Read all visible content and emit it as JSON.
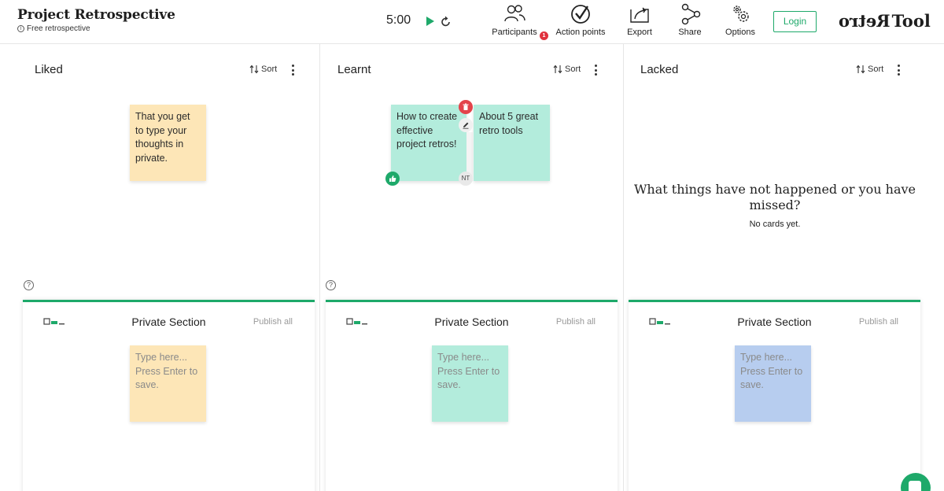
{
  "header": {
    "title": "Project Retrospective",
    "subtitle": "Free retrospective",
    "timer": "5:00",
    "tools": [
      {
        "label": "Participants",
        "icon": "participants-icon",
        "badge": "1"
      },
      {
        "label": "Action points",
        "icon": "action-points-icon"
      },
      {
        "label": "Export",
        "icon": "export-icon"
      },
      {
        "label": "Share",
        "icon": "share-icon"
      },
      {
        "label": "Options",
        "icon": "options-gear-icon"
      }
    ],
    "login_label": "Login",
    "logo": {
      "mirrored": "Retro",
      "text": "Tool"
    }
  },
  "columns": [
    {
      "title": "Liked",
      "sort_label": "Sort",
      "cards": [
        {
          "text": "That you get to type your thoughts in private.",
          "color": "#fde6b7"
        }
      ],
      "private": {
        "title": "Private Section",
        "publish_label": "Publish all",
        "placeholder": "Type here... Press Enter to save.",
        "color": "#fde6b7"
      }
    },
    {
      "title": "Learnt",
      "sort_label": "Sort",
      "cards": [
        {
          "text": "How to create effective project retros!",
          "color": "#b3ecdc",
          "author_initials": "NT"
        },
        {
          "text": "About 5 great retro tools",
          "color": "#b3ecdc"
        }
      ],
      "private": {
        "title": "Private Section",
        "publish_label": "Publish all",
        "placeholder": "Type here... Press Enter to save.",
        "color": "#b3ecdc"
      }
    },
    {
      "title": "Lacked",
      "sort_label": "Sort",
      "empty_title": "What things have not happened or you have missed?",
      "empty_sub": "No cards yet.",
      "private": {
        "title": "Private Section",
        "publish_label": "Publish all",
        "placeholder": "Type here... Press Enter to save.",
        "color": "#b7cdef"
      }
    }
  ],
  "colors": {
    "accent": "#1ea96a",
    "delete": "#e3434b",
    "badge": "#e0323e"
  }
}
